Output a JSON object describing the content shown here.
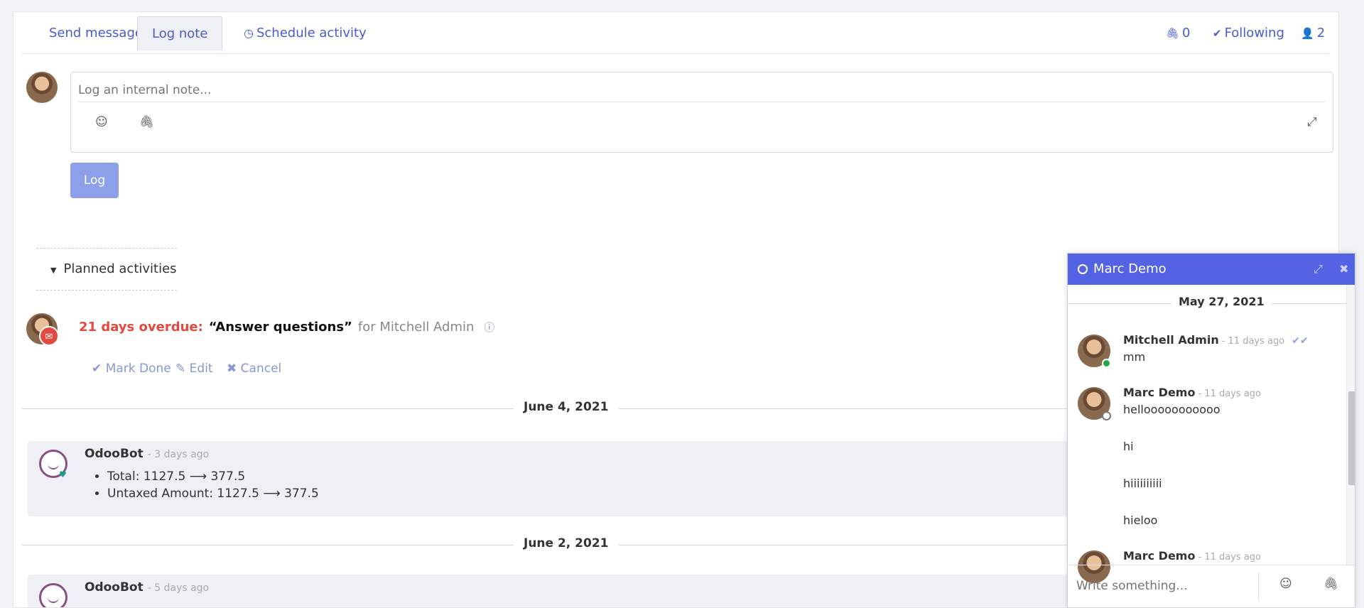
{
  "topbar": {
    "send_message": "Send message",
    "log_note": "Log note",
    "schedule_activity": "Schedule activity",
    "attachments_count": "0",
    "following": "Following",
    "followers_count": "2"
  },
  "composer": {
    "placeholder": "Log an internal note...",
    "emoji_icon": "smiley-icon",
    "attach_icon": "paperclip-icon",
    "expand_icon": "expand-icon",
    "log_button": "Log"
  },
  "planned": {
    "header": "Planned activities",
    "activity": {
      "overdue": "21 days overdue:",
      "summary": "“Answer questions”",
      "for": "for Mitchell Admin",
      "mark_done": "Mark Done",
      "edit": "Edit",
      "cancel": "Cancel"
    }
  },
  "thread": {
    "dates": [
      "June 4, 2021",
      "June 2, 2021"
    ],
    "messages": [
      {
        "author": "OdooBot",
        "when": "- 3 days ago",
        "tracking": [
          "Total: 1127.5 ⟶ 377.5",
          "Untaxed Amount: 1127.5 ⟶ 377.5"
        ]
      },
      {
        "author": "OdooBot",
        "when": "- 5 days ago"
      }
    ]
  },
  "chat": {
    "title": "Marc Demo",
    "date": "May 27, 2021",
    "messages": [
      {
        "author": "Mitchell Admin",
        "when": "- 11 days ago",
        "text": "mm"
      },
      {
        "author": "Marc Demo",
        "when": "- 11 days ago",
        "text": "hellooooooooooo"
      },
      {
        "text": "hi"
      },
      {
        "text": "hiiiiiiiiii"
      },
      {
        "text": "hieloo"
      },
      {
        "author": "Marc Demo",
        "when": "- 11 days ago"
      }
    ],
    "input_placeholder": "Write something..."
  },
  "colors": {
    "accent": "#5363e4",
    "link": "#4a5bcf",
    "overdue": "#e3493f",
    "log_button": "#8d9fe8",
    "online": "#28a745"
  }
}
